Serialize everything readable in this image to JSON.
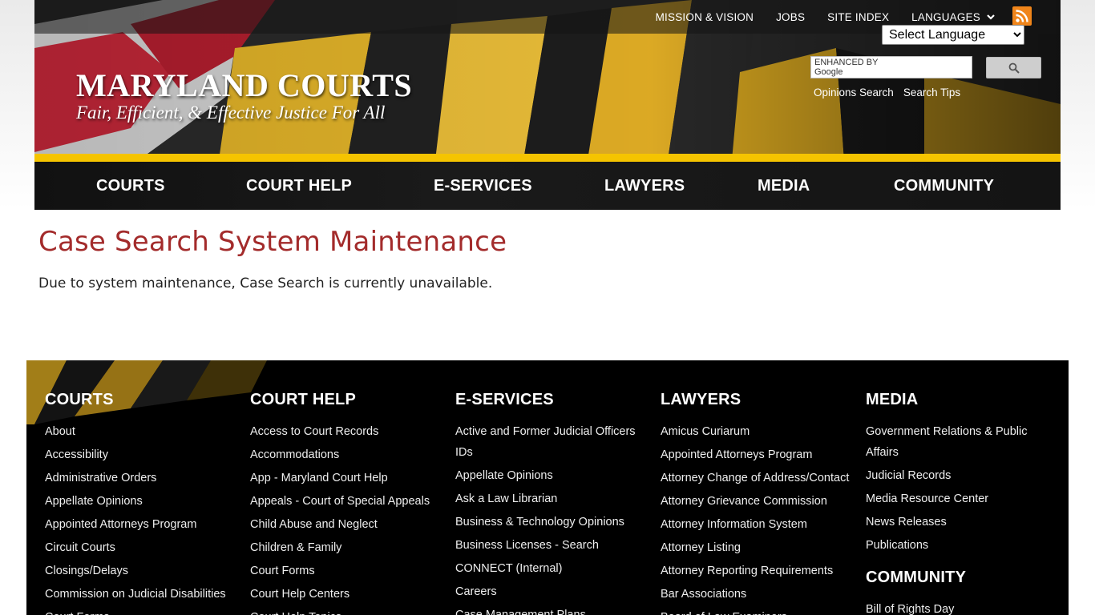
{
  "header": {
    "top_links": [
      "MISSION & VISION",
      "JOBS",
      "SITE INDEX"
    ],
    "languages_label": "LANGUAGES",
    "language_select": "Select Language",
    "brand_title": "MARYLAND COURTS",
    "brand_tagline": "Fair, Efficient, & Effective Justice For All",
    "search_label": "ENHANCED BY Google",
    "search_links": [
      "Opinions Search",
      "Search Tips"
    ]
  },
  "nav": [
    "COURTS",
    "COURT HELP",
    "E-SERVICES",
    "LAWYERS",
    "MEDIA",
    "COMMUNITY"
  ],
  "main": {
    "title": "Case Search System Maintenance",
    "body": "Due to system maintenance, Case Search is currently unavailable."
  },
  "footer": {
    "columns": [
      {
        "heading": "COURTS",
        "items": [
          "About",
          "Accessibility",
          "Administrative Orders",
          "Appellate Opinions",
          "Appointed Attorneys Program",
          "Circuit Courts",
          "Closings/Delays",
          "Commission on Judicial Disabilities",
          "Court Forms"
        ]
      },
      {
        "heading": "COURT HELP",
        "items": [
          "Access to Court Records",
          "Accommodations",
          "App - Maryland Court Help",
          "Appeals - Court of Special Appeals",
          "Child Abuse and Neglect",
          "Children & Family",
          "Court Forms",
          "Court Help Centers",
          "Court Help Topics"
        ]
      },
      {
        "heading": "E-SERVICES",
        "items": [
          "Active and Former Judicial Officers IDs",
          "Appellate Opinions",
          "Ask a Law Librarian",
          "Business & Technology Opinions",
          "Business Licenses - Search",
          "CONNECT (Internal)",
          "Careers",
          "Case Management Plans"
        ]
      },
      {
        "heading": "LAWYERS",
        "items": [
          "Amicus Curiarum",
          "Appointed Attorneys Program",
          "Attorney Change of Address/Contact",
          "Attorney Grievance Commission",
          "Attorney Information System",
          "Attorney Listing",
          "Attorney Reporting Requirements",
          "Bar Associations",
          "Board of Law Examiners"
        ]
      },
      {
        "heading": "MEDIA",
        "items": [
          "Government Relations & Public Affairs",
          "Judicial Records",
          "Media Resource Center",
          "News Releases",
          "Publications"
        ]
      }
    ],
    "community_heading": "COMMUNITY",
    "community_items": [
      "Bill of Rights Day"
    ]
  },
  "colors": {
    "title_red": "#a32b2b",
    "gold": "#f5c400",
    "rss_orange": "#f0851a"
  },
  "icons": [
    "chevron-down-icon",
    "rss-icon",
    "search-icon"
  ]
}
